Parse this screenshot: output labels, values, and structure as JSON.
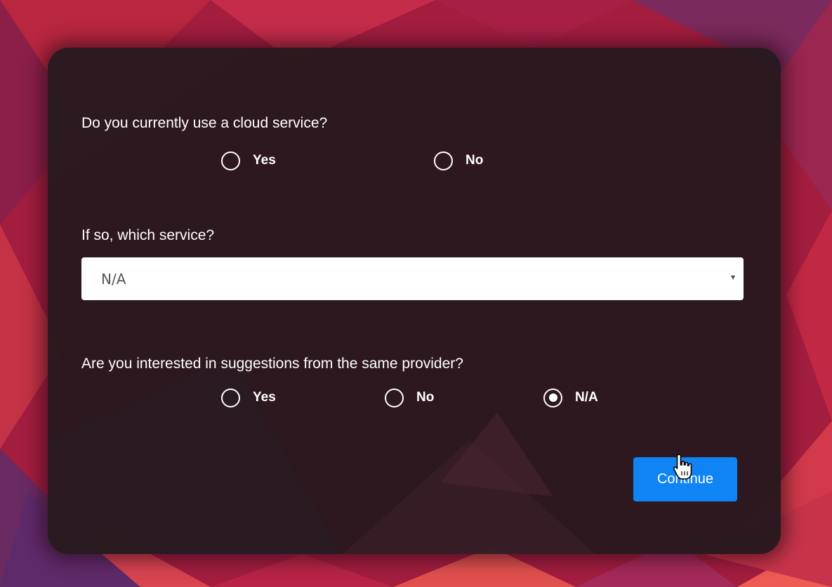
{
  "form": {
    "q1": {
      "label": "Do you currently use a cloud service?",
      "options": [
        {
          "label": "Yes",
          "checked": false
        },
        {
          "label": "No",
          "checked": false
        }
      ]
    },
    "q2": {
      "label": "If so, which service?",
      "select_value": "N/A",
      "arrow": "▾"
    },
    "q3": {
      "label": "Are you interested in suggestions from the same provider?",
      "options": [
        {
          "label": "Yes",
          "checked": false
        },
        {
          "label": "No",
          "checked": false
        },
        {
          "label": "N/A",
          "checked": true
        }
      ]
    },
    "continue_label": "Continue"
  },
  "colors": {
    "card": "#22181c",
    "accent": "#1184f5",
    "background_red": "#c8203f",
    "background_purple": "#5a2a6a"
  },
  "icons": {
    "cursor": "hand-pointer-icon",
    "dropdown": "caret-down-icon"
  }
}
